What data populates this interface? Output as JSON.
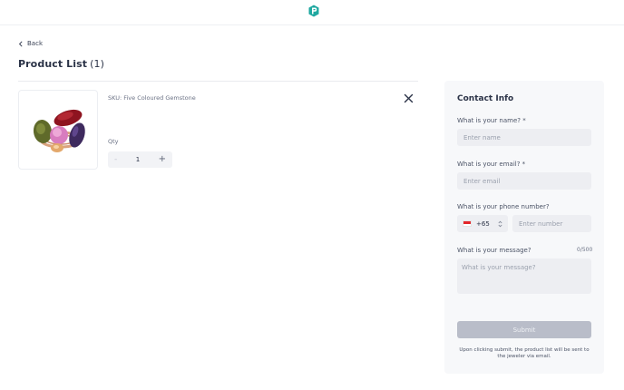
{
  "header": {
    "logo_icon": "brand-logo-icon",
    "brand_color": "#1fa8a0"
  },
  "nav": {
    "back_label": "Back"
  },
  "product_list": {
    "title": "Product List",
    "count": "(1)",
    "items": [
      {
        "sku": "SKU: Five Coloured Gemstone",
        "qty_label": "Qty",
        "qty_value": "1",
        "minus": "-",
        "plus": "+"
      }
    ]
  },
  "contact": {
    "title": "Contact Info",
    "name_label": "What is your name? *",
    "name_placeholder": "Enter name",
    "email_label": "What is your email? *",
    "email_placeholder": "Enter email",
    "phone_label": "What is your phone number?",
    "country_code": "+65",
    "phone_placeholder": "Enter number",
    "message_label": "What is your message?",
    "message_counter": "0/500",
    "message_placeholder": "What is your message?",
    "submit_label": "Submit",
    "note": "Upon clicking submit, the product list will be sent to the jeweler via email."
  }
}
